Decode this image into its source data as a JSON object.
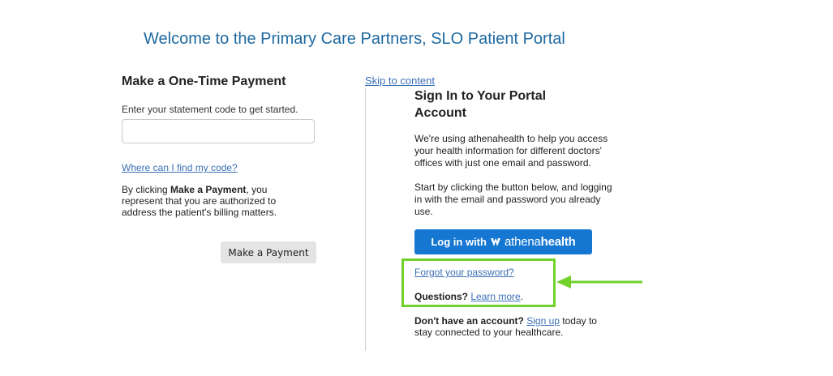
{
  "page": {
    "title": "Welcome to the Primary Care Partners, SLO Patient Portal"
  },
  "payment": {
    "heading": "Make a One-Time Payment",
    "prompt": "Enter your statement code to get started.",
    "code_input_value": "",
    "code_input_placeholder": "",
    "find_code_link": "Where can I find my code?",
    "auth_prefix": "By clicking ",
    "auth_bold": "Make a Payment",
    "auth_suffix": ", you represent that you are authorized to address the patient's billing matters.",
    "button_label": "Make a Payment"
  },
  "signin": {
    "skip_link": "Skip to content",
    "heading": "Sign In to Your Portal Account",
    "info1": "We're using athenahealth to help you access your health information for different doctors' offices with just one email and password.",
    "info2": "Start by clicking the button below, and logging in with the email and password you already use.",
    "login_prefix": "Log in with ",
    "login_brand_light": "athena",
    "login_brand_bold": "health",
    "forgot_link": "Forgot your password?",
    "questions_label": "Questions?",
    "learn_more_link": "Learn more",
    "learn_more_suffix": ".",
    "no_account_label": "Don't have an account?",
    "signup_link": "Sign up",
    "signup_suffix": " today to stay connected to your healthcare."
  },
  "annotation": {
    "highlight_color": "#6fd12a",
    "arrow_color": "#6fd12a"
  },
  "colors": {
    "title": "#1e69a0",
    "link": "#3a6fb6",
    "login_button": "#1677d2"
  }
}
